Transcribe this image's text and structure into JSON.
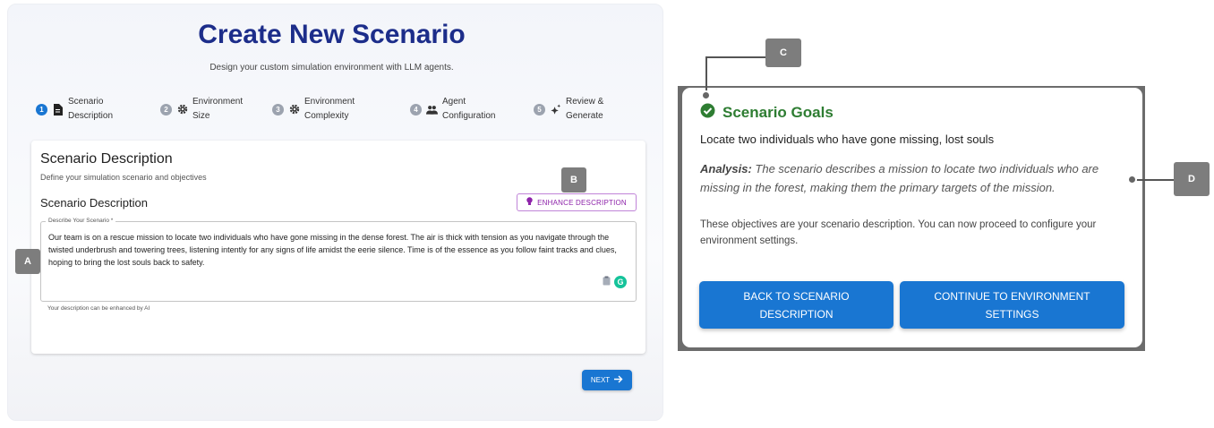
{
  "header": {
    "title": "Create New Scenario",
    "subtitle": "Design your custom simulation environment with LLM agents."
  },
  "steps": [
    {
      "num": "1",
      "label": "Scenario\nDescription",
      "icon": "document-icon"
    },
    {
      "num": "2",
      "label": "Environment\nSize",
      "icon": "gear-icon"
    },
    {
      "num": "3",
      "label": "Environment\nComplexity",
      "icon": "gear-icon"
    },
    {
      "num": "4",
      "label": "Agent\nConfiguration",
      "icon": "people-icon"
    },
    {
      "num": "5",
      "label": "Review &\nGenerate",
      "icon": "sparkle-icon"
    }
  ],
  "card": {
    "title": "Scenario Description",
    "subtitle": "Define your simulation scenario and objectives",
    "section_title": "Scenario Description",
    "enhance_label": "ENHANCE DESCRIPTION",
    "field_label": "Describe Your Scenario *",
    "field_value": "Our team is on a rescue mission to locate two individuals who have gone missing in the dense forest. The air is thick with tension as you navigate through the twisted underbrush and towering trees, listening intently for any signs of life amidst the eerie silence. Time is of the essence as you follow faint tracks and clues, hoping to bring the lost souls back to safety.",
    "helper": "Your description can be enhanced by AI",
    "grammarly_badge": "G"
  },
  "next_label": "NEXT",
  "callouts": {
    "a": "A",
    "b": "B",
    "c": "C",
    "d": "D"
  },
  "dialog": {
    "title": "Scenario Goals",
    "goal": "Locate two individuals who have gone missing, lost souls",
    "analysis_label": "Analysis:",
    "analysis_text": " The scenario describes a mission to locate two individuals who are missing in the forest, making them the primary targets of the mission.",
    "note": "These objectives are your scenario description. You can now proceed to configure your environment settings.",
    "back_label": "BACK TO SCENARIO DESCRIPTION",
    "continue_label": "CONTINUE TO ENVIRONMENT SETTINGS"
  },
  "colors": {
    "primary": "#1976d2",
    "title": "#1c2d8a",
    "success": "#2e7d32",
    "enhance": "#8e24aa",
    "callout": "#7d7d7d"
  }
}
